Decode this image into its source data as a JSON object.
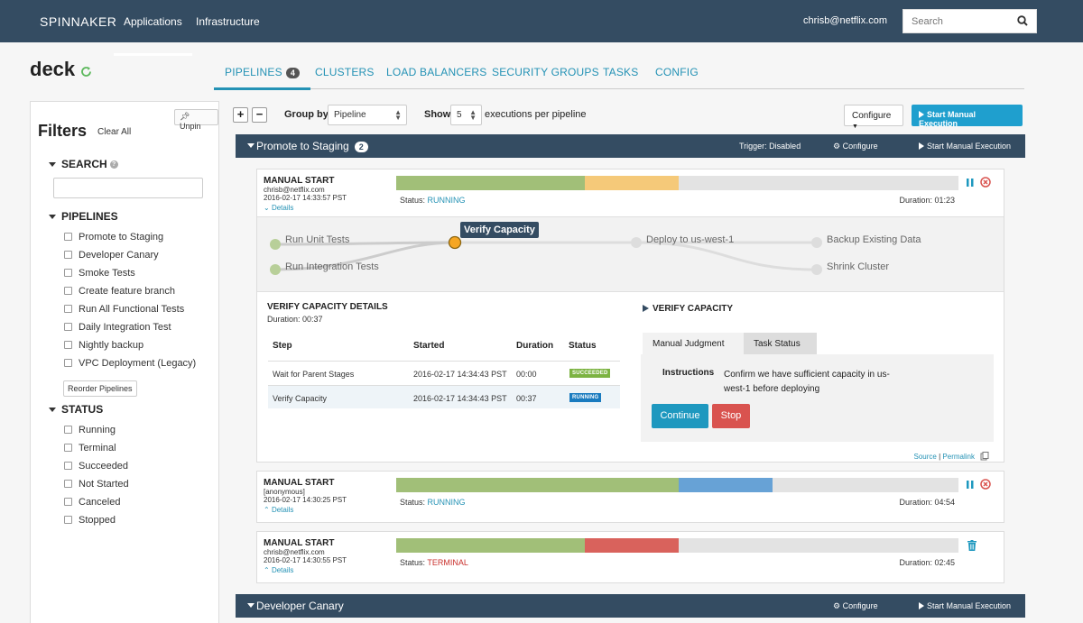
{
  "nav": {
    "brand": "SPINNAKER",
    "links": [
      "Applications",
      "Infrastructure"
    ],
    "user": "chrisb@netflix.com",
    "search_placeholder": "Search"
  },
  "app": {
    "name": "deck",
    "tabs": [
      {
        "label": "PIPELINES",
        "count": "4"
      },
      {
        "label": "CLUSTERS"
      },
      {
        "label": "LOAD BALANCERS"
      },
      {
        "label": "SECURITY GROUPS"
      },
      {
        "label": "TASKS"
      },
      {
        "label": "CONFIG"
      }
    ]
  },
  "sidebar": {
    "unpin": "Unpin",
    "title": "Filters",
    "clear_all": "Clear All",
    "search_header": "SEARCH",
    "pipelines_header": "PIPELINES",
    "pipelines": [
      "Promote to Staging",
      "Developer Canary",
      "Smoke Tests",
      "Create feature branch",
      "Run All Functional Tests",
      "Daily Integration Test",
      "Nightly backup",
      "VPC Deployment (Legacy)"
    ],
    "reorder": "Reorder Pipelines",
    "status_header": "STATUS",
    "statuses": [
      "Running",
      "Terminal",
      "Succeeded",
      "Not Started",
      "Canceled",
      "Stopped"
    ]
  },
  "toolbar": {
    "plus": "+",
    "minus": "−",
    "group_by_label": "Group by",
    "group_by_value": "Pipeline",
    "show_label": "Show",
    "show_value": "5",
    "executions_label": "executions per pipeline",
    "configure": "Configure",
    "start_manual": "Start Manual Execution"
  },
  "groups": [
    {
      "name": "Promote to Staging",
      "count": "2",
      "trigger": "Trigger: Disabled",
      "configure": "Configure",
      "start": "Start Manual Execution"
    },
    {
      "name": "Developer Canary",
      "configure": "Configure",
      "start": "Start Manual Execution"
    }
  ],
  "executions": [
    {
      "title": "MANUAL START",
      "user": "chrisb@netflix.com",
      "time": "2016-02-17 14:33:57 PST",
      "details": "Details",
      "status_label": "Status:",
      "status": "RUNNING",
      "duration": "Duration: 01:23",
      "progress": [
        {
          "fraction": 0.336,
          "color": "#a1bf78"
        },
        {
          "fraction": 0.167,
          "color": "#f5c979"
        }
      ]
    },
    {
      "title": "MANUAL START",
      "user": "[anonymous]",
      "time": "2016-02-17 14:30:25 PST",
      "details": "Details",
      "status_label": "Status:",
      "status": "RUNNING",
      "duration": "Duration: 04:54",
      "progress": [
        {
          "fraction": 0.503,
          "color": "#a1bf78"
        },
        {
          "fraction": 0.167,
          "color": "#67a2d6"
        }
      ]
    },
    {
      "title": "MANUAL START",
      "user": "chrisb@netflix.com",
      "time": "2016-02-17 14:30:55 PST",
      "details": "Details",
      "status_label": "Status:",
      "status": "TERMINAL",
      "duration": "Duration: 02:45",
      "progress": [
        {
          "fraction": 0.336,
          "color": "#a1bf78"
        },
        {
          "fraction": 0.167,
          "color": "#d9625c"
        }
      ]
    }
  ],
  "graph": {
    "nodes": [
      "Run Unit Tests",
      "Run Integration Tests",
      "Verify Capacity",
      "Deploy to us-west-1",
      "Backup Existing Data",
      "Shrink Cluster"
    ]
  },
  "stage_details": {
    "title": "VERIFY CAPACITY DETAILS",
    "duration": "Duration: 00:37",
    "headers": [
      "Step",
      "Started",
      "Duration",
      "Status"
    ],
    "rows": [
      {
        "step": "Wait for Parent Stages",
        "started": "2016-02-17 14:34:43 PST",
        "duration": "00:00",
        "status": "SUCCEEDED"
      },
      {
        "step": "Verify Capacity",
        "started": "2016-02-17 14:34:43 PST",
        "duration": "00:37",
        "status": "RUNNING"
      }
    ]
  },
  "verify": {
    "title": "VERIFY CAPACITY",
    "tabs": [
      "Manual Judgment",
      "Task Status"
    ],
    "instructions_label": "Instructions",
    "instructions": "Confirm we have sufficient capacity in us-west-1 before deploying",
    "continue": "Continue",
    "stop": "Stop",
    "source": "Source",
    "sep": "|",
    "permalink": "Permalink"
  },
  "colors": {
    "nav_bg": "#344c62",
    "accent": "#2492b5",
    "primary_button": "#1f9fce",
    "success": "#7cb342",
    "running": "#1a7bbf",
    "danger": "#d9534f"
  }
}
